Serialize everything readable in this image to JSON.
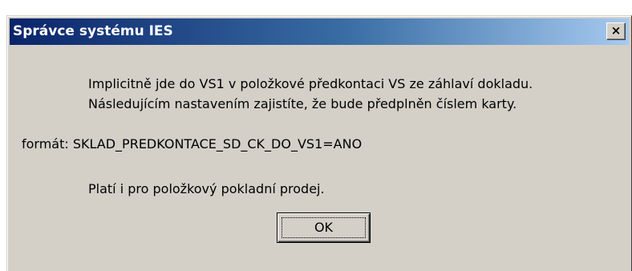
{
  "dialog": {
    "title": "Správce systému IES",
    "close_label": "×",
    "message": {
      "line1": "Implicitně jde do VS1 v položkové předkontaci VS ze záhlaví dokladu.",
      "line2": "Následujícím nastavením zajistíte, že bude předplněn číslem karty.",
      "format_line": "formát: SKLAD_PREDKONTACE_SD_CK_DO_VS1=ANO",
      "note": "Platí i pro položkový pokladní prodej."
    },
    "ok_label": "OK"
  },
  "colors": {
    "titlebar_start": "#0a246a",
    "titlebar_end": "#a6caf0",
    "dialog_bg": "#d4d0c8"
  },
  "icons": {
    "close": "close-icon"
  }
}
